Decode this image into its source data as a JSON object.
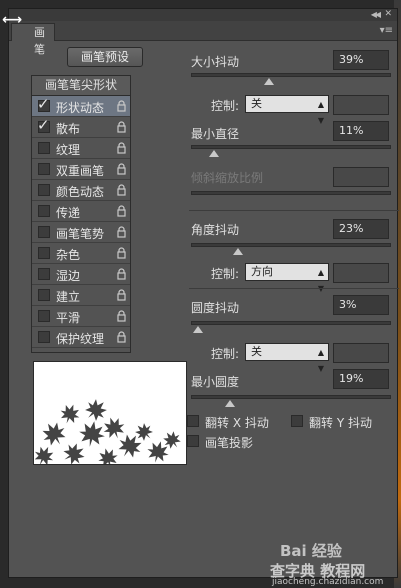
{
  "panel": {
    "tab_label": "画笔",
    "preset_button": "画笔预设"
  },
  "tip_list": {
    "header": "画笔笔尖形状",
    "items": [
      {
        "label": "形状动态",
        "checked": true,
        "selected": true
      },
      {
        "label": "散布",
        "checked": true,
        "selected": false
      },
      {
        "label": "纹理",
        "checked": false,
        "selected": false
      },
      {
        "label": "双重画笔",
        "checked": false,
        "selected": false
      },
      {
        "label": "颜色动态",
        "checked": false,
        "selected": false
      },
      {
        "label": "传递",
        "checked": false,
        "selected": false
      },
      {
        "label": "画笔笔势",
        "checked": false,
        "selected": false
      },
      {
        "label": "杂色",
        "checked": false,
        "selected": false
      },
      {
        "label": "湿边",
        "checked": false,
        "selected": false
      },
      {
        "label": "建立",
        "checked": false,
        "selected": false
      },
      {
        "label": "平滑",
        "checked": false,
        "selected": false
      },
      {
        "label": "保护纹理",
        "checked": false,
        "selected": false
      }
    ]
  },
  "controls": {
    "size_jitter": {
      "label": "大小抖动",
      "value": "39%",
      "level": 0.39
    },
    "control1": {
      "label": "控制:",
      "value": "关"
    },
    "min_diameter": {
      "label": "最小直径",
      "value": "11%",
      "level": 0.11
    },
    "tilt_scale": {
      "label": "倾斜缩放比例"
    },
    "angle_jitter": {
      "label": "角度抖动",
      "value": "23%",
      "level": 0.23
    },
    "control2": {
      "label": "控制:",
      "value": "方向"
    },
    "roundness_jitter": {
      "label": "圆度抖动",
      "value": "3%",
      "level": 0.03
    },
    "control3": {
      "label": "控制:",
      "value": "关"
    },
    "min_roundness": {
      "label": "最小圆度",
      "value": "19%",
      "level": 0.19
    },
    "flip_x": "翻转 X 抖动",
    "flip_y": "翻转 Y 抖动",
    "brush_projection": "画笔投影"
  },
  "watermark": {
    "line1": "Bai 经验",
    "line2": "查字典 教程网",
    "url": "jiaocheng.chazidian.com"
  }
}
